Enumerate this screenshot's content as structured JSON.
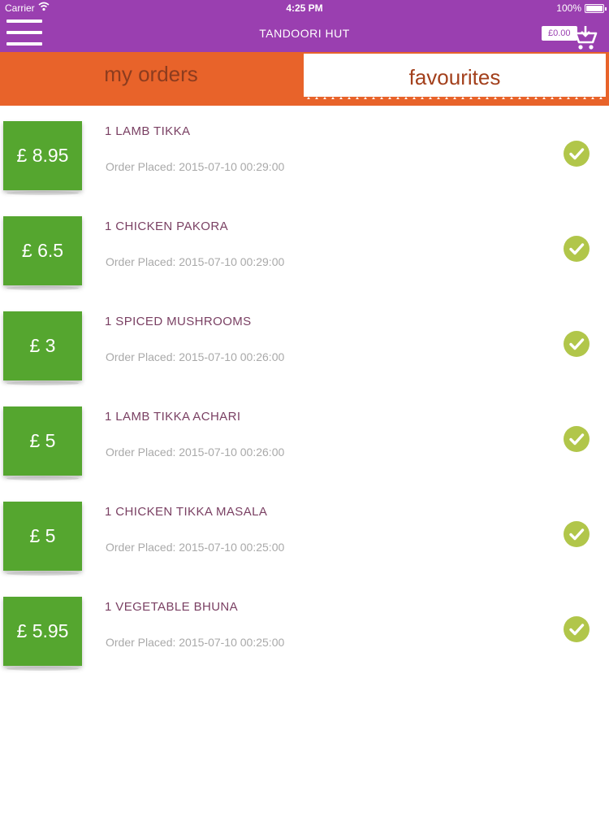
{
  "status_bar": {
    "carrier": "Carrier",
    "time": "4:25 PM",
    "battery": "100%"
  },
  "header": {
    "title": "TANDOORI HUT",
    "cart_amount": "£0.00",
    "menu_icon": "hamburger-menu-icon",
    "cart_icon": "shopping-cart-icon"
  },
  "tabs": [
    {
      "label": "my orders",
      "active": false
    },
    {
      "label": "favourites",
      "active": true
    }
  ],
  "colors": {
    "header": "#9a3fb0",
    "tab": "#e8632a",
    "price_badge": "#55a62f",
    "check": "#b1c64a"
  },
  "orders": [
    {
      "price": "£ 8.95",
      "title": "1 LAMB TIKKA",
      "date": "Order Placed: 2015-07-10 00:29:00"
    },
    {
      "price": "£ 6.5",
      "title": "1 CHICKEN PAKORA",
      "date": "Order Placed: 2015-07-10 00:29:00"
    },
    {
      "price": "£ 3",
      "title": "1 SPICED MUSHROOMS",
      "date": "Order Placed: 2015-07-10 00:26:00"
    },
    {
      "price": "£ 5",
      "title": "1 LAMB TIKKA ACHARI",
      "date": "Order Placed: 2015-07-10 00:26:00"
    },
    {
      "price": "£ 5",
      "title": "1 CHICKEN TIKKA MASALA",
      "date": "Order Placed: 2015-07-10 00:25:00"
    },
    {
      "price": "£ 5.95",
      "title": "1 VEGETABLE BHUNA",
      "date": "Order Placed: 2015-07-10 00:25:00"
    }
  ]
}
